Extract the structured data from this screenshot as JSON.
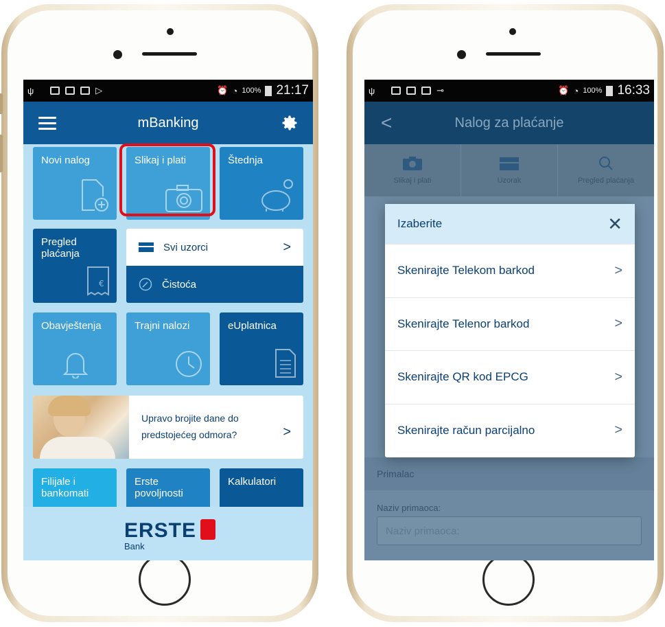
{
  "left_phone": {
    "status": {
      "time": "21:17",
      "battery": "100%"
    },
    "app_title": "mBanking",
    "tiles": {
      "novi_nalog": "Novi nalog",
      "slikaj_i_plati": "Slikaj i plati",
      "stednja": "Štednja",
      "pregled_placanja": "Pregled plaćanja",
      "svi_uzorci": "Svi uzorci",
      "cistoca": "Čistoća",
      "obavjestenja": "Obavještenja",
      "trajni_nalozi": "Trajni nalozi",
      "euplatnica": "eUplatnica",
      "filijale": "Filijale i bankomati",
      "erste_povoljnosti": "Erste povoljnosti",
      "kalkulatori": "Kalkulatori"
    },
    "promo": {
      "line1": "Upravo brojite dane do",
      "line2": "predstojećeg odmora?"
    },
    "logo": {
      "name": "ERSTE",
      "sub": "Bank"
    }
  },
  "right_phone": {
    "status": {
      "time": "16:33",
      "battery": "100%"
    },
    "app_title": "Nalog za plaćanje",
    "toolbar": [
      {
        "label": "Slikaj i plati",
        "icon": "camera-icon"
      },
      {
        "label": "Uzorak",
        "icon": "tray-icon"
      },
      {
        "label": "Pregled plaćanja",
        "icon": "search-icon"
      }
    ],
    "background": {
      "section_label": "Primalac",
      "field_label": "Naziv primaoca:",
      "field_placeholder": "Naziv primaoca:"
    },
    "dialog": {
      "title": "Izaberite",
      "options": [
        "Skenirajte Telekom barkod",
        "Skenirajte Telenor barkod",
        "Skenirajte QR kod EPCG",
        "Skenirajte račun parcijalno"
      ]
    }
  },
  "colors": {
    "brand_blue": "#0f5a96",
    "tile_light": "#3ea0d6",
    "tile_dark": "#0b5897",
    "highlight_red": "#e0101b"
  }
}
